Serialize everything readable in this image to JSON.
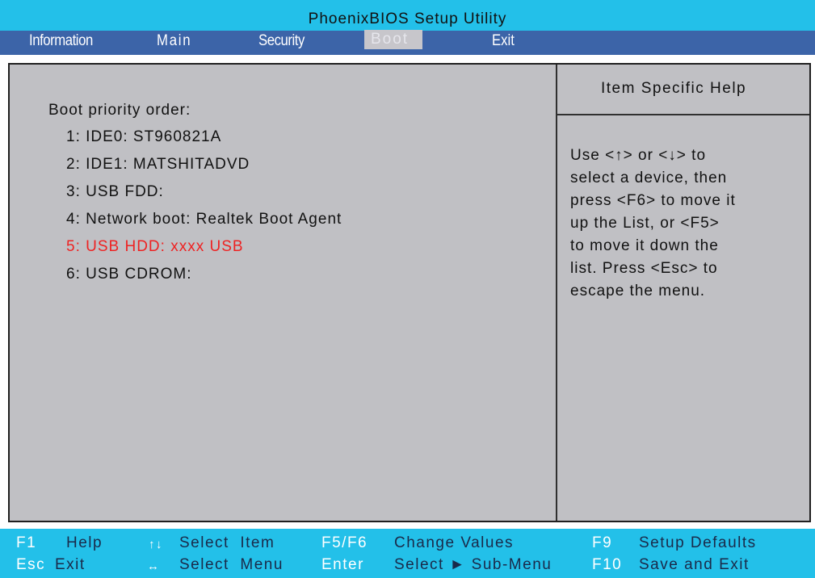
{
  "window": {
    "title": "PhoenixBIOS Setup Utility"
  },
  "menu": {
    "information": "Information",
    "main": "Main",
    "security": "Security",
    "boot": "Boot",
    "exit": "Exit"
  },
  "boot": {
    "label": "Boot priority order:",
    "items": [
      "1: IDE0: ST960821A",
      "2: IDE1: MATSHITADVD",
      "3: USB FDD:",
      "4: Network boot: Realtek Boot Agent",
      "5: USB HDD: xxxx USB",
      "6: USB CDROM:"
    ],
    "selected_index": 4
  },
  "help": {
    "title": "Item Specific Help",
    "lines": [
      "Use <↑> or <↓> to",
      "select a device, then",
      "press <F6> to move it",
      "up the List, or <F5>",
      "to move it down the",
      "list. Press <Esc> to",
      "escape the menu."
    ]
  },
  "footer": {
    "row1": {
      "f1": "F1",
      "help": "Help",
      "updown_arrows": "↑↓",
      "select_item": "Select  Item",
      "f5f6": "F5/F6",
      "change_values": "Change Values",
      "f9": "F9",
      "setup_defaults": "Setup Defaults"
    },
    "row2": {
      "esc": "Esc",
      "exit": "Exit",
      "leftright_arrows": "↔",
      "select_menu": "Select  Menu",
      "enter": "Enter",
      "select_submenu": "Select ► Sub-Menu",
      "f10": "F10",
      "save_exit": "Save and Exit"
    }
  },
  "colors": {
    "title_bg": "#23c0e9",
    "menu_bg": "#3c64a8",
    "panel_bg": "#c0c0c4",
    "selected_text": "#ee2222",
    "key_text": "#ffffff"
  }
}
